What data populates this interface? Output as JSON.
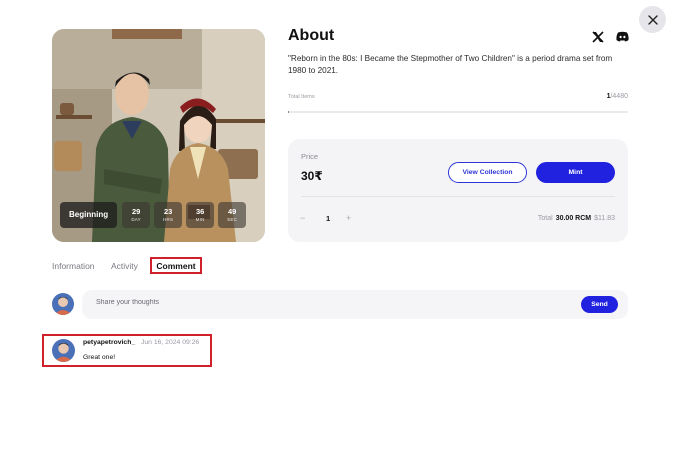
{
  "close": {
    "icon": "close-icon"
  },
  "poster": {
    "timer": {
      "status": "Beginning",
      "units": [
        {
          "value": "29",
          "label": "DAY"
        },
        {
          "value": "23",
          "label": "HRS"
        },
        {
          "value": "36",
          "label": "MIN"
        },
        {
          "value": "49",
          "label": "SEC"
        }
      ]
    }
  },
  "about": {
    "title": "About",
    "social": [
      "x-icon",
      "discord-icon"
    ],
    "description": "\"Reborn in the 80s: I Became the Stepmother of Two Children\" is a period drama set from 1980 to 2021.",
    "total_items_label": "Total Items",
    "minted": "1",
    "total": "/4480",
    "progress_fraction": 0.000223
  },
  "price": {
    "label": "Price",
    "value": "30₹",
    "view_collection": "View Collection",
    "mint": "Mint",
    "quantity": "1",
    "minus": "−",
    "plus": "+",
    "total_label": "Total",
    "total_amount": "30.00 RCM",
    "total_usd": "$11.83"
  },
  "tabs": [
    {
      "label": "Information",
      "active": false
    },
    {
      "label": "Activity",
      "active": false
    },
    {
      "label": "Comment",
      "active": true
    }
  ],
  "comment_input": {
    "placeholder": "Share your thoughts",
    "value": "",
    "send": "Send"
  },
  "comments": [
    {
      "user": "petyapetrovich_",
      "time": "Jun 16, 2024 09:26",
      "text": "Great one!"
    }
  ],
  "colors": {
    "accent": "#2121e0",
    "highlight": "#d0202a"
  }
}
